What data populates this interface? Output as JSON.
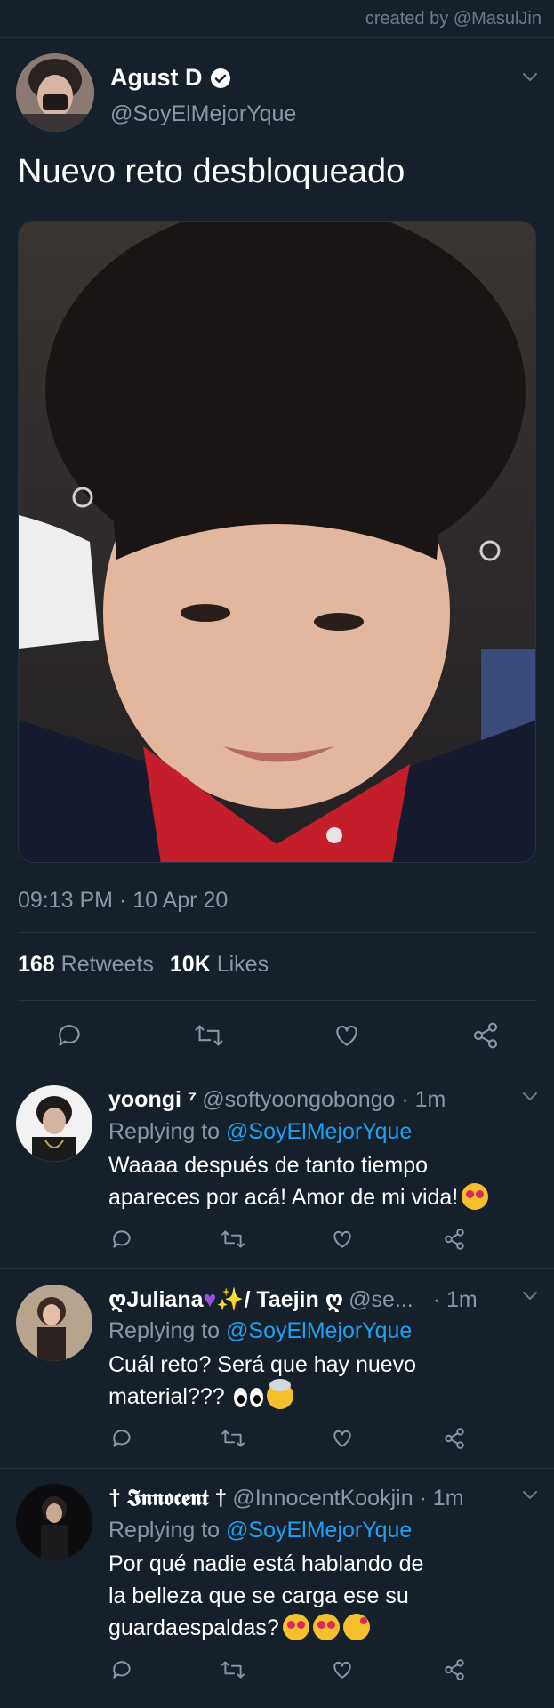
{
  "credit": "created by @MasulJin",
  "colors": {
    "background": "#15202b",
    "link": "#1da1f2",
    "secondary_text": "#8899a6",
    "divider": "#253341"
  },
  "tweet": {
    "name": "Agust D",
    "handle": "@SoyElMejorYque",
    "text": "Nuevo reto desbloqueado",
    "timestamp": "09:13 PM · 10 Apr 20",
    "retweets_count": "168",
    "retweets_label": "Retweets",
    "likes_count": "10K",
    "likes_label": "Likes",
    "icons": [
      "reply-icon",
      "retweet-icon",
      "like-icon",
      "share-icon"
    ]
  },
  "replies": [
    {
      "name": "yoongi ⁷",
      "handle": "@softyoongobongo · 1m",
      "replying_prefix": "Replying to ",
      "replying_to": "@SoyElMejorYque",
      "line1": "Waaaa después de tanto tiempo",
      "line2": "apareces por acá! Amor de mi vida!"
    },
    {
      "name_a": "ღJuliana",
      "name_b": "✨/ Taejin ღ",
      "handle": "@se...",
      "time": "· 1m",
      "replying_prefix": "Replying to ",
      "replying_to": "@SoyElMejorYque",
      "line1": "Cuál reto? Será que hay nuevo",
      "line2": "material???"
    },
    {
      "name": "† 𝕴𝖓𝖓𝖔𝖈𝖊𝖓𝖙 †",
      "handle": "@InnocentKookjin · 1m",
      "replying_prefix": "Replying to ",
      "replying_to": "@SoyElMejorYque",
      "line1": "Por qué nadie está hablando de",
      "line2": "la belleza que se carga ese su",
      "line3": "guardaespaldas?"
    }
  ]
}
